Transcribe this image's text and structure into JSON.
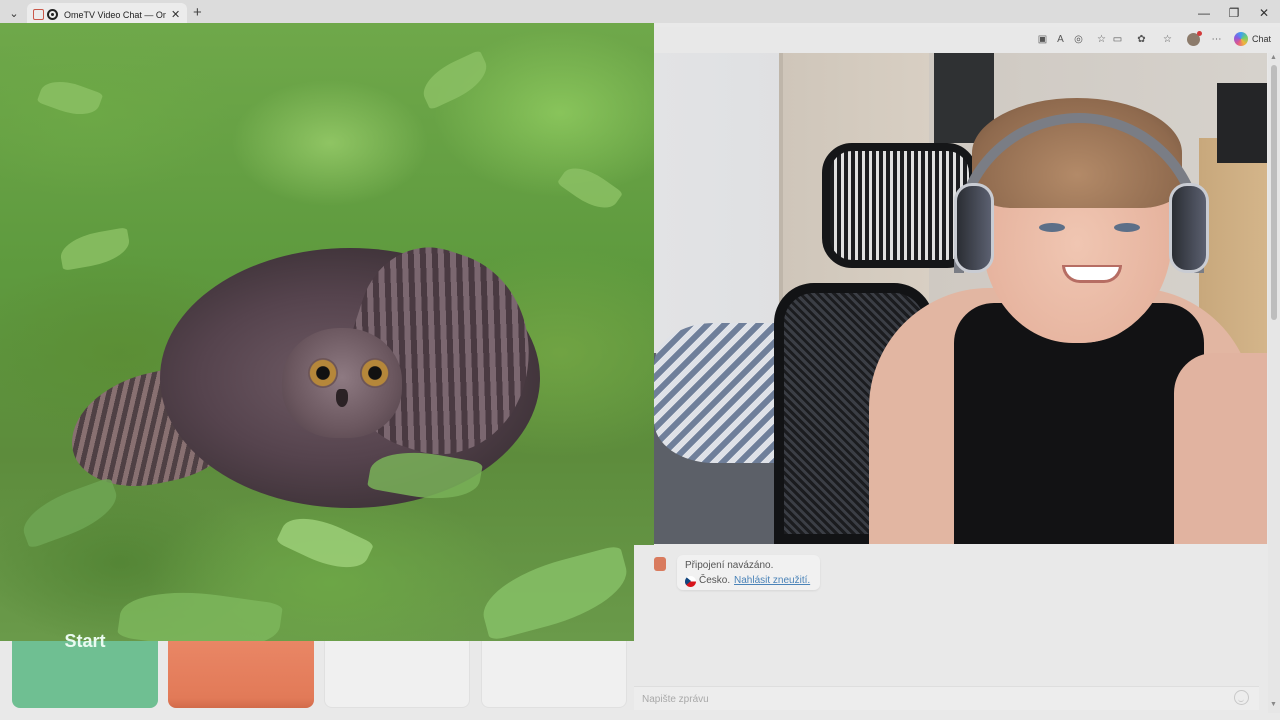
{
  "browser": {
    "tab_title": "OmeTV Video Chat — Omeg",
    "tab_close": "✕",
    "new_tab": "+",
    "tab_list": "⌄",
    "window_controls": {
      "minimize": "—",
      "restore": "❐",
      "close": "✕"
    },
    "toolbar_icons": [
      "app-icon",
      "translate-icon",
      "reader-icon",
      "favorite-icon",
      "pip-icon",
      "extensions-icon",
      "favorites-icon",
      "profile-icon",
      "more-icon"
    ],
    "more_label": "⋯",
    "chat_label": "Chat"
  },
  "remote_feed": {
    "description_icon": "remote-video"
  },
  "chat": {
    "system_message": {
      "line1": "Připojení navázáno.",
      "country": "Česko.",
      "report_link": "Nahlásit zneužití."
    },
    "input": {
      "placeholder": "Napište zprávu",
      "value": ""
    }
  },
  "controls": {
    "start_label": "Start",
    "stop_label": "",
    "extra1_label": "",
    "extra2_label": ""
  },
  "colors": {
    "start_button": "#6fbf92",
    "stop_button": "#e27a58",
    "report_link": "#4a83b8"
  }
}
